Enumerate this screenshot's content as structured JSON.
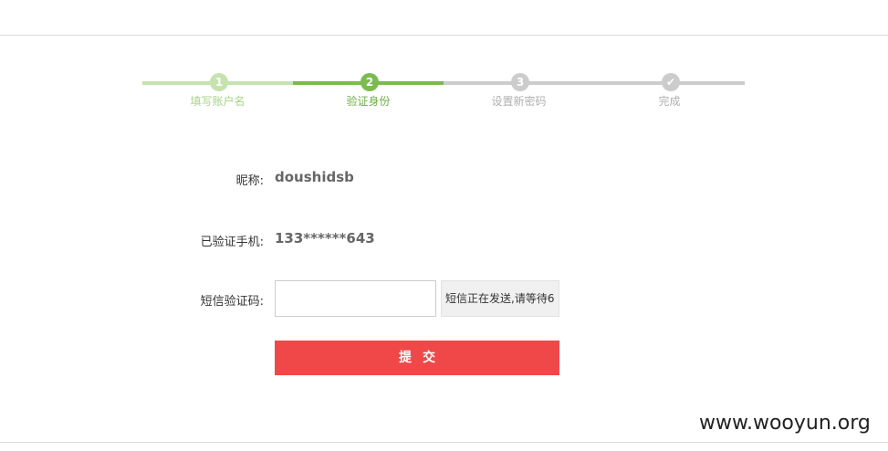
{
  "stepper": {
    "steps": [
      {
        "marker": "1",
        "label": "填写账户名",
        "state": "done",
        "color": "#c5e3ad",
        "text_color": "#a8d38a"
      },
      {
        "marker": "2",
        "label": "验证身份",
        "state": "active",
        "color": "#7bbb4f",
        "text_color": "#6fae45"
      },
      {
        "marker": "3",
        "label": "设置新密码",
        "state": "pending",
        "color": "#cccccc",
        "text_color": "#b0b0b0"
      },
      {
        "marker": "✔",
        "label": "完成",
        "state": "pending",
        "color": "#cccccc",
        "text_color": "#b0b0b0"
      }
    ]
  },
  "form": {
    "nickname_label": "昵称:",
    "nickname_value": "doushidsb",
    "phone_label": "已验证手机:",
    "phone_value": "133******643",
    "sms_label": "短信验证码:",
    "sms_value": "",
    "sms_button_label": "短信正在发送,请等待6",
    "submit_label": "提交"
  },
  "watermark": "www.wooyun.org",
  "colors": {
    "accent_green": "#7bbb4f",
    "light_green": "#c5e3ad",
    "gray": "#cccccc",
    "submit_red": "#f04848"
  }
}
